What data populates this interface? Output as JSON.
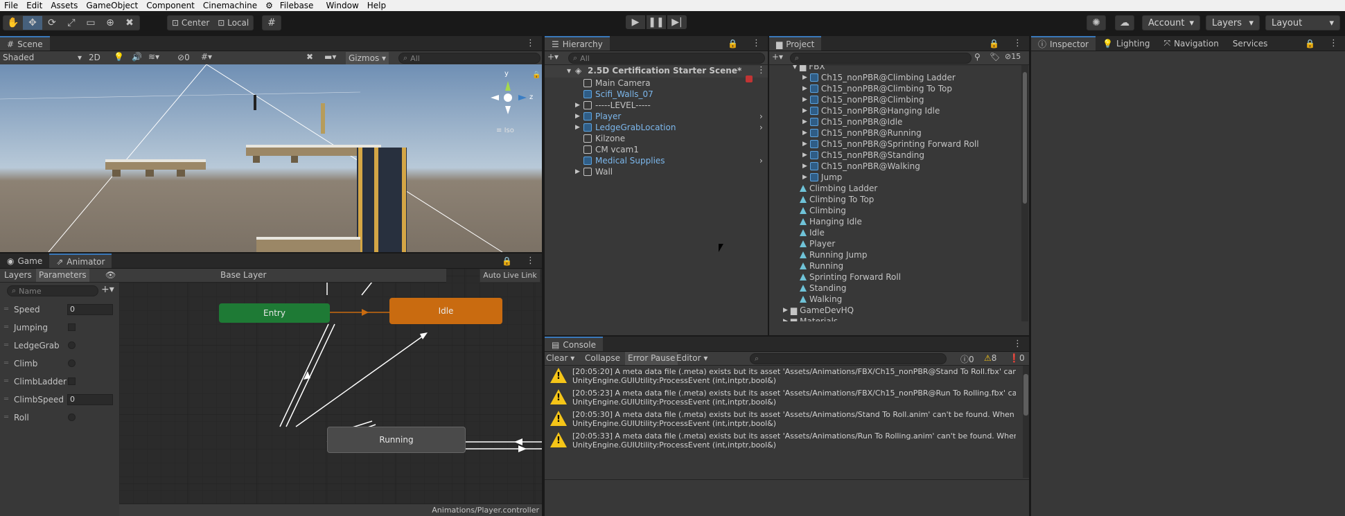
{
  "menu": [
    "File",
    "Edit",
    "Assets",
    "GameObject",
    "Component",
    "Cinemachine",
    "Filebase",
    "Window",
    "Help"
  ],
  "toolbar": {
    "pivot": "Center",
    "space": "Local",
    "account": "Account",
    "layers": "Layers",
    "layout": "Layout"
  },
  "scene": {
    "tab": "Scene",
    "shading": "Shaded",
    "mode2d": "2D",
    "fx_count": "0",
    "gizmos": "Gizmos",
    "search_placeholder": "All",
    "persp": "Iso",
    "axis_y": "y",
    "axis_z": "z"
  },
  "hierarchy": {
    "tab": "Hierarchy",
    "search_placeholder": "All",
    "scene_name": "2.5D Certification Starter Scene*",
    "items": [
      {
        "label": "Main Camera",
        "prefab": false,
        "arrow": false
      },
      {
        "label": "Scifi_Walls_07",
        "prefab": true,
        "arrow": false
      },
      {
        "label": "-----LEVEL-----",
        "prefab": false,
        "arrow": true
      },
      {
        "label": "Player",
        "prefab": true,
        "arrow": true
      },
      {
        "label": "LedgeGrabLocation",
        "prefab": true,
        "arrow": true
      },
      {
        "label": "Kilzone",
        "prefab": false,
        "arrow": false
      },
      {
        "label": "CM vcam1",
        "prefab": false,
        "arrow": false
      },
      {
        "label": "Medical Supplies",
        "prefab": true,
        "arrow": false
      },
      {
        "label": "Wall",
        "prefab": false,
        "arrow": true
      }
    ]
  },
  "project": {
    "tab": "Project",
    "hidden_count": "15",
    "folder": "FBX",
    "fbx_items": [
      "Ch15_nonPBR@Climbing Ladder",
      "Ch15_nonPBR@Climbing To Top",
      "Ch15_nonPBR@Climbing",
      "Ch15_nonPBR@Hanging Idle",
      "Ch15_nonPBR@Idle",
      "Ch15_nonPBR@Running",
      "Ch15_nonPBR@Sprinting Forward Roll",
      "Ch15_nonPBR@Standing",
      "Ch15_nonPBR@Walking",
      "Jump"
    ],
    "anim_items": [
      "Climbing Ladder",
      "Climbing To Top",
      "Climbing",
      "Hanging Idle",
      "Idle",
      "Player",
      "Running Jump",
      "Running",
      "Sprinting Forward Roll",
      "Standing",
      "Walking"
    ],
    "folders": [
      "GameDevHQ",
      "Materials"
    ]
  },
  "inspector": {
    "tabs": [
      "Inspector",
      "Lighting",
      "Navigation",
      "Services"
    ]
  },
  "animator": {
    "tabs": [
      "Game",
      "Animator"
    ],
    "subtabs": [
      "Layers",
      "Parameters"
    ],
    "name_placeholder": "Name",
    "layer": "Base Layer",
    "live_link": "Auto Live Link",
    "footer": "Animations/Player.controller",
    "parameters": [
      {
        "name": "Speed",
        "type": "float",
        "value": "0"
      },
      {
        "name": "Jumping",
        "type": "bool",
        "value": ""
      },
      {
        "name": "LedgeGrab",
        "type": "trigger",
        "value": ""
      },
      {
        "name": "Climb",
        "type": "trigger",
        "value": ""
      },
      {
        "name": "ClimbLadder",
        "type": "bool",
        "value": ""
      },
      {
        "name": "ClimbSpeed",
        "type": "float",
        "value": "0"
      },
      {
        "name": "Roll",
        "type": "trigger",
        "value": ""
      }
    ],
    "nodes": {
      "entry": "Entry",
      "idle": "Idle",
      "running": "Running"
    },
    "colors": {
      "entry": "#1e7a35",
      "idle": "#c96b10",
      "running": "#4a4a4a"
    }
  },
  "console": {
    "tab": "Console",
    "clear": "Clear",
    "collapse": "Collapse",
    "error_pause": "Error Pause",
    "editor": "Editor",
    "info_count": "0",
    "warn_count": "8",
    "error_count": "0",
    "messages": [
      {
        "line1": "[20:05:20] A meta data file (.meta) exists but its asset 'Assets/Animations/FBX/Ch15_nonPBR@Stand To Roll.fbx' can",
        "line2": "UnityEngine.GUIUtility:ProcessEvent (int,intptr,bool&)"
      },
      {
        "line1": "[20:05:23] A meta data file (.meta) exists but its asset 'Assets/Animations/FBX/Ch15_nonPBR@Run To Rolling.fbx' ca",
        "line2": "UnityEngine.GUIUtility:ProcessEvent (int,intptr,bool&)"
      },
      {
        "line1": "[20:05:30] A meta data file (.meta) exists but its asset 'Assets/Animations/Stand To Roll.anim' can't be found. When m",
        "line2": "UnityEngine.GUIUtility:ProcessEvent (int,intptr,bool&)"
      },
      {
        "line1": "[20:05:33] A meta data file (.meta) exists but its asset 'Assets/Animations/Run To Rolling.anim' can't be found. When",
        "line2": "UnityEngine.GUIUtility:ProcessEvent (int,intptr,bool&)"
      }
    ]
  }
}
